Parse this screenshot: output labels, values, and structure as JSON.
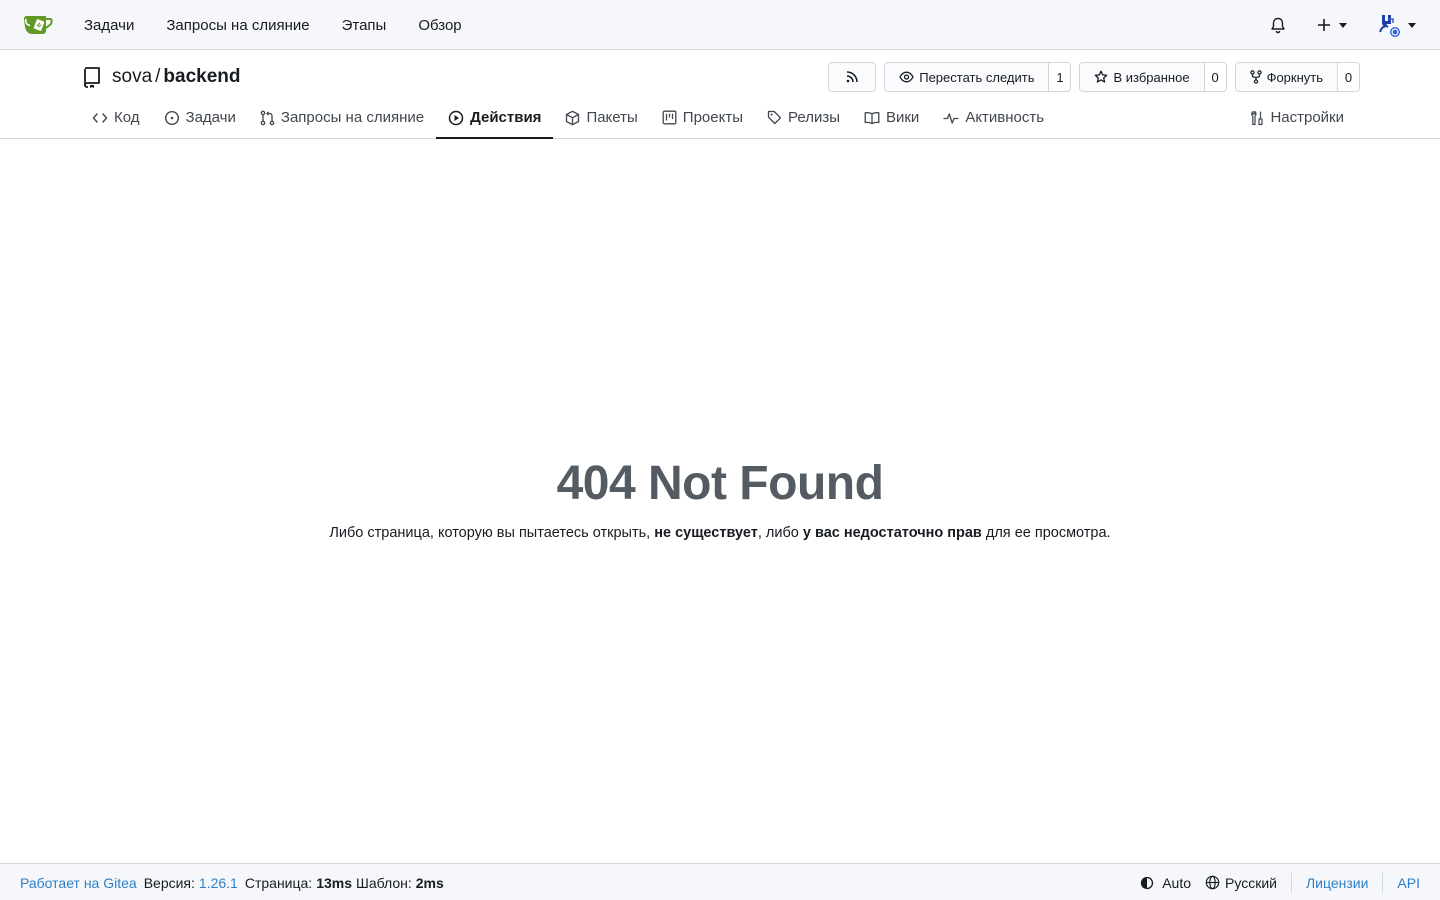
{
  "navbar": {
    "links": [
      "Задачи",
      "Запросы на слияние",
      "Этапы",
      "Обзор"
    ]
  },
  "repo": {
    "owner": "sova",
    "separator": "/",
    "name": "backend",
    "unwatch_label": "Перестать следить",
    "watch_count": "1",
    "star_label": "В избранное",
    "star_count": "0",
    "fork_label": "Форкнуть",
    "fork_count": "0"
  },
  "tabs": [
    {
      "label": "Код",
      "icon": "code-icon"
    },
    {
      "label": "Задачи",
      "icon": "issue-opened-icon"
    },
    {
      "label": "Запросы на слияние",
      "icon": "git-pull-request-icon"
    },
    {
      "label": "Действия",
      "icon": "play-icon",
      "active": true
    },
    {
      "label": "Пакеты",
      "icon": "package-icon"
    },
    {
      "label": "Проекты",
      "icon": "project-icon"
    },
    {
      "label": "Релизы",
      "icon": "tag-icon"
    },
    {
      "label": "Вики",
      "icon": "book-icon"
    },
    {
      "label": "Активность",
      "icon": "pulse-icon"
    }
  ],
  "settings_tab": {
    "label": "Настройки",
    "icon": "tools-icon"
  },
  "error": {
    "title": "404 Not Found",
    "desc_1": "Либо страница, которую вы пытаетесь открыть, ",
    "desc_bold_1": "не существует",
    "desc_2": ", либо ",
    "desc_bold_2": "у вас недостаточно прав",
    "desc_3": " для ее просмотра."
  },
  "footer": {
    "powered_by": "Работает на Gitea",
    "version_label": "Версия:",
    "version": "1.26.1",
    "page_label": "Страница:",
    "page_time": "13ms",
    "template_label": "Шаблон:",
    "template_time": "2ms",
    "theme": "Auto",
    "language": "Русский",
    "licenses": "Лицензии",
    "api": "API"
  },
  "colors": {
    "navbar_bg": "#f6f7fa",
    "logo_green": "#609926",
    "link_blue": "#2e7fc7",
    "error_title": "#555b63"
  }
}
